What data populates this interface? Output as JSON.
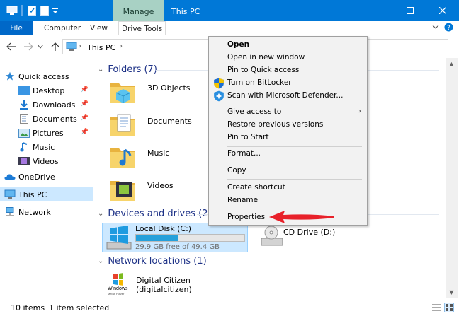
{
  "titlebar": {
    "manage_label": "Manage",
    "title": "This PC",
    "bg_color": "#0078d7"
  },
  "ribbon": {
    "tabs": [
      {
        "label": "File"
      },
      {
        "label": "Computer"
      },
      {
        "label": "View"
      },
      {
        "label": "Drive Tools"
      }
    ]
  },
  "address": {
    "path": "This PC",
    "icons": [
      "back-arrow-icon",
      "forward-arrow-icon",
      "recent-dropdown-icon",
      "up-arrow-icon"
    ]
  },
  "navpane": {
    "items": [
      {
        "label": "Quick access",
        "icon": "star-icon"
      },
      {
        "label": "Desktop",
        "icon": "desktop-folder-icon",
        "pinned": true
      },
      {
        "label": "Downloads",
        "icon": "downloads-folder-icon",
        "pinned": true
      },
      {
        "label": "Documents",
        "icon": "documents-folder-icon",
        "pinned": true
      },
      {
        "label": "Pictures",
        "icon": "pictures-folder-icon",
        "pinned": true
      },
      {
        "label": "Music",
        "icon": "music-folder-icon"
      },
      {
        "label": "Videos",
        "icon": "videos-folder-icon"
      },
      {
        "label": "OneDrive",
        "icon": "onedrive-cloud-icon"
      },
      {
        "label": "This PC",
        "icon": "this-pc-icon",
        "selected": true
      },
      {
        "label": "Network",
        "icon": "network-icon"
      }
    ]
  },
  "content": {
    "folders_header": "Folders (7)",
    "folders": [
      {
        "label": "3D Objects"
      },
      {
        "label": "Documents"
      },
      {
        "label": "Music"
      },
      {
        "label": "Videos"
      }
    ],
    "devices_header": "Devices and drives (2)",
    "local_disk": {
      "label": "Local Disk (C:)",
      "free_text": "29.9 GB free of 49.4 GB",
      "used_fraction": 0.395
    },
    "cd_drive": {
      "label": "CD Drive (D:)"
    },
    "network_header": "Network locations (1)",
    "network_item": {
      "label": "Digital Citizen (digitalcitizen)",
      "logo_line1": "Windows",
      "logo_line2": "Media Player"
    }
  },
  "status": {
    "items_count": "10 items",
    "selected": "1 item selected"
  },
  "context_menu": {
    "items": [
      {
        "label": "Open",
        "bold": true
      },
      {
        "label": "Open in new window"
      },
      {
        "label": "Pin to Quick access"
      },
      {
        "label": "Turn on BitLocker",
        "icon": "shield-icon"
      },
      {
        "label": "Scan with Microsoft Defender...",
        "icon": "defender-icon"
      },
      {
        "label": "Give access to",
        "submenu": true
      },
      {
        "label": "Restore previous versions"
      },
      {
        "label": "Pin to Start"
      },
      {
        "label": "Format..."
      },
      {
        "label": "Copy"
      },
      {
        "label": "Create shortcut"
      },
      {
        "label": "Rename"
      },
      {
        "label": "Properties"
      }
    ]
  },
  "colors": {
    "accent": "#0078d7",
    "selected_bg": "#cce8ff",
    "group_header": "#1e3287",
    "drive_bar_fill": "#26a0da",
    "annotation_arrow": "#e8212a"
  }
}
